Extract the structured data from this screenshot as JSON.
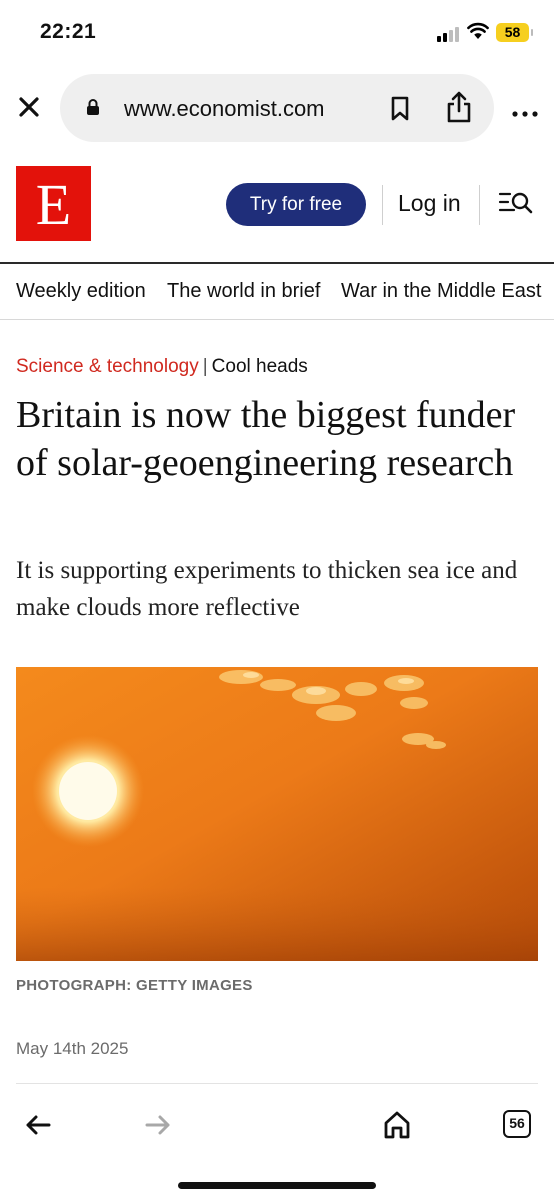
{
  "status_bar": {
    "time": "22:21",
    "battery_level": "58",
    "signal_bars": 2,
    "battery_color": "#f6cf1f"
  },
  "browser": {
    "url": "www.economist.com",
    "icons": [
      "close-icon",
      "lock-icon",
      "bookmark-icon",
      "share-icon",
      "more-icon"
    ]
  },
  "site_header": {
    "logo_letter": "E",
    "try_button_label": "Try for free",
    "login_label": "Log in",
    "brand_red": "#e3120b",
    "button_navy": "#1f2e7a"
  },
  "nav": {
    "items": [
      "Weekly edition",
      "The world in brief",
      "War in the Middle East"
    ]
  },
  "article": {
    "section": "Science & technology",
    "separator": "|",
    "rubric": "Cool heads",
    "headline": "Britain is now the biggest funder of solar-geoengineering research",
    "subheadline": "It is supporting experiments to thicken sea ice and make clouds more reflective",
    "photo_credit": "PHOTOGRAPH: GETTY IMAGES",
    "date": "May 14th 2025",
    "section_color": "#d0291f"
  },
  "bottom_bar": {
    "tab_count": "56",
    "icons": [
      "back-arrow-icon",
      "forward-arrow-icon",
      "home-icon",
      "tabs-icon"
    ]
  }
}
